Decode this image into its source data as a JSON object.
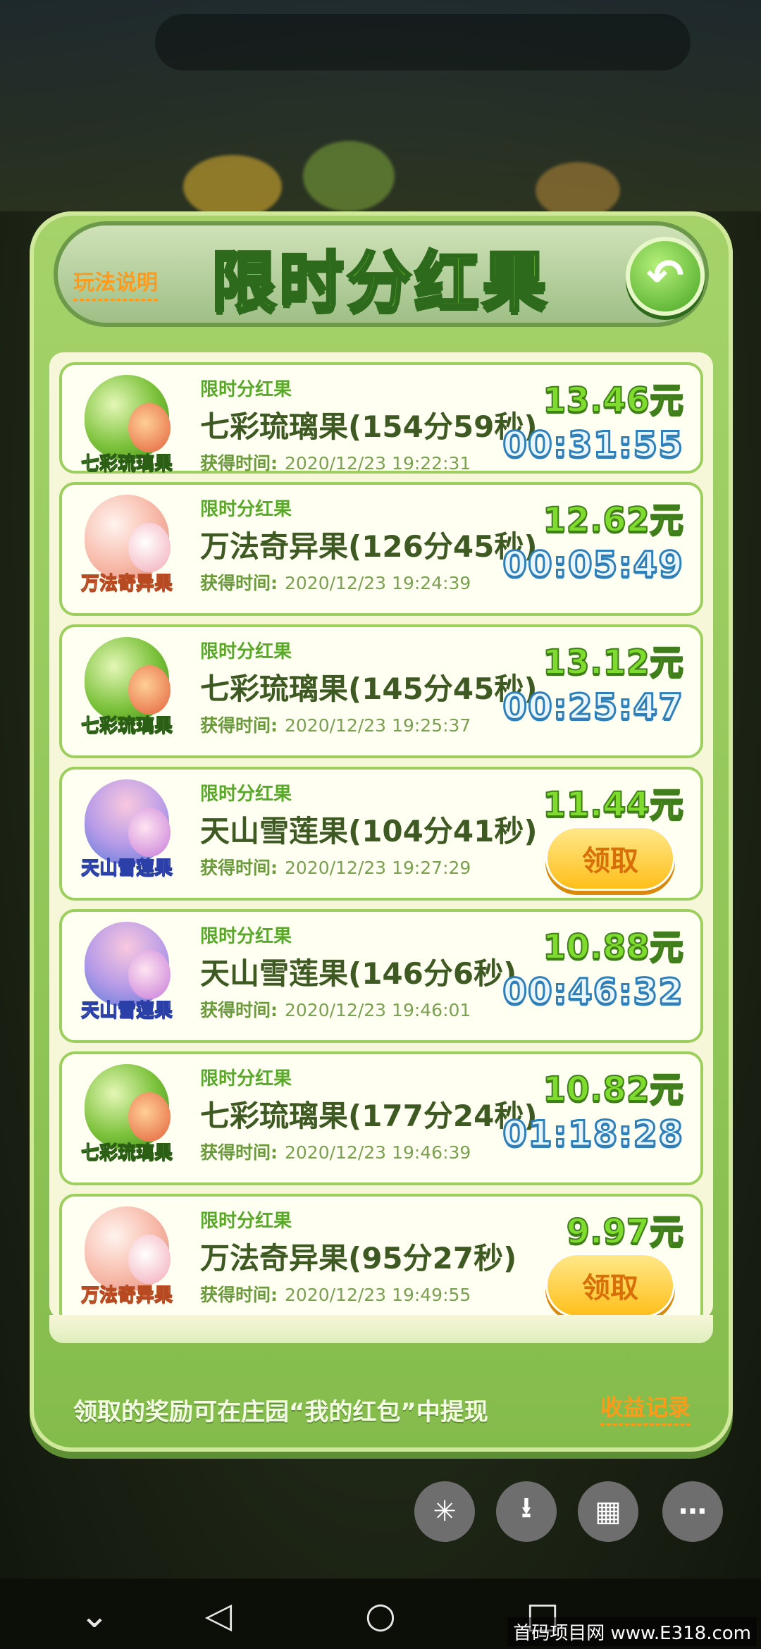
{
  "dialog": {
    "title": "限时分红果",
    "rules_link": "玩法说明",
    "back_icon": "back-arrow-icon"
  },
  "time_label": "获得时间:",
  "claim_label": "领取",
  "items": [
    {
      "tag": "限时分红果",
      "name": "七彩琉璃果(154分59秒)",
      "fruit_label": "七彩琉璃果",
      "fruit": "liuli",
      "time": "2020/12/23  19:22:31",
      "amount": "13.46元",
      "countdown": "00:31:55"
    },
    {
      "tag": "限时分红果",
      "name": "万法奇异果(126分45秒)",
      "fruit_label": "万法奇异果",
      "fruit": "wanfa",
      "time": "2020/12/23  19:24:39",
      "amount": "12.62元",
      "countdown": "00:05:49"
    },
    {
      "tag": "限时分红果",
      "name": "七彩琉璃果(145分45秒)",
      "fruit_label": "七彩琉璃果",
      "fruit": "liuli",
      "time": "2020/12/23  19:25:37",
      "amount": "13.12元",
      "countdown": "00:25:47"
    },
    {
      "tag": "限时分红果",
      "name": "天山雪莲果(104分41秒)",
      "fruit_label": "天山雪莲果",
      "fruit": "xuelian",
      "time": "2020/12/23  19:27:29",
      "amount": "11.44元",
      "countdown": ""
    },
    {
      "tag": "限时分红果",
      "name": "天山雪莲果(146分6秒)",
      "fruit_label": "天山雪莲果",
      "fruit": "xuelian",
      "time": "2020/12/23  19:46:01",
      "amount": "10.88元",
      "countdown": "00:46:32"
    },
    {
      "tag": "限时分红果",
      "name": "七彩琉璃果(177分24秒)",
      "fruit_label": "七彩琉璃果",
      "fruit": "liuli",
      "time": "2020/12/23  19:46:39",
      "amount": "10.82元",
      "countdown": "01:18:28"
    },
    {
      "tag": "限时分红果",
      "name": "万法奇异果(95分27秒)",
      "fruit_label": "万法奇异果",
      "fruit": "wanfa",
      "time": "2020/12/23  19:49:55",
      "amount": "9.97元",
      "countdown": ""
    }
  ],
  "footer": {
    "note": "领取的奖励可在庄园“我的红包”中提现",
    "income_link": "收益记录"
  },
  "toolbar": {
    "buttons": [
      "sparkle-icon",
      "download-icon",
      "grid-icon",
      "more-icon"
    ]
  },
  "navbar": {
    "buttons": [
      "chevron-down-icon",
      "back-triangle-icon",
      "home-circle-icon",
      "recent-square-icon"
    ]
  },
  "watermark": "首码项目网 www.E318.com"
}
